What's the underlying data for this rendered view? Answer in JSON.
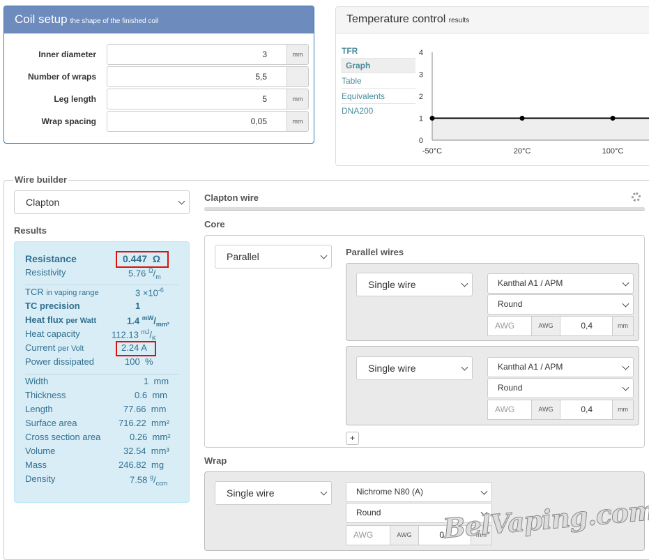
{
  "coil_setup": {
    "title": "Coil setup",
    "subtitle": "the shape of the finished coil",
    "fields": [
      {
        "label": "Inner diameter",
        "value": "3",
        "unit": "mm"
      },
      {
        "label": "Number of wraps",
        "value": "5,5",
        "unit": ""
      },
      {
        "label": "Leg length",
        "value": "5",
        "unit": "mm"
      },
      {
        "label": "Wrap spacing",
        "value": "0,05",
        "unit": "mm"
      }
    ]
  },
  "temperature_control": {
    "title": "Temperature control",
    "subtitle": "results",
    "nav": [
      "TFR",
      "Graph",
      "Table",
      "Equivalents",
      "DNA200"
    ],
    "active_nav": "Graph"
  },
  "chart_data": {
    "type": "line",
    "x": [
      "-50°C",
      "20°C",
      "100°C"
    ],
    "series": [
      {
        "values": [
          1,
          1,
          1
        ]
      }
    ],
    "y_ticks": [
      "0",
      "1",
      "2",
      "3",
      "4"
    ],
    "ylim": [
      0,
      4
    ],
    "line_color": "#000000",
    "fill_color": "#eeeeee"
  },
  "wire_builder": {
    "legend": "Wire builder",
    "wire_type": "Clapton",
    "results_heading": "Results",
    "results": {
      "resistance_label": "Resistance",
      "resistance_value": "0.447",
      "resistance_unit": "Ω",
      "resistivity_label": "Resistivity",
      "resistivity_value": "5.76",
      "resistivity_unit_top": "Ω",
      "resistivity_unit_bottom": "m",
      "tcr_label": "TCR",
      "tcr_small": "in vaping range",
      "tcr_value": "3 ×10",
      "tcr_exp": "-6",
      "tc_precision_label": "TC precision",
      "tc_precision_value": "1",
      "heat_flux_label": "Heat flux",
      "heat_flux_small": "per Watt",
      "heat_flux_value": "1.4",
      "heat_flux_unit_top": "mW",
      "heat_flux_unit_bottom": "mm²",
      "heat_capacity_label": "Heat capacity",
      "heat_capacity_value": "112.13",
      "heat_capacity_unit_top": "mJ",
      "heat_capacity_unit_bottom": "K",
      "current_label": "Current",
      "current_small": "per Volt",
      "current_value": "2.24",
      "current_unit": "A",
      "power_label": "Power dissipated",
      "power_value": "100",
      "power_unit": "%",
      "width_label": "Width",
      "width_value": "1",
      "width_unit": "mm",
      "thickness_label": "Thickness",
      "thickness_value": "0.6",
      "thickness_unit": "mm",
      "length_label": "Length",
      "length_value": "77.66",
      "length_unit": "mm",
      "surface_label": "Surface area",
      "surface_value": "716.22",
      "surface_unit": "mm²",
      "cross_label": "Cross section area",
      "cross_value": "0.26",
      "cross_unit": "mm²",
      "volume_label": "Volume",
      "volume_value": "32.54",
      "volume_unit": "mm³",
      "mass_label": "Mass",
      "mass_value": "246.82",
      "mass_unit": "mg",
      "density_label": "Density",
      "density_value": "7.58",
      "density_unit_top": "g",
      "density_unit_bottom": "ccm"
    },
    "clapton_title": "Clapton wire",
    "core_heading": "Core",
    "core_mode": "Parallel",
    "parallel_heading": "Parallel wires",
    "parallel_wires": [
      {
        "type": "Single wire",
        "material": "Kanthal A1 / APM",
        "shape": "Round",
        "awg_placeholder": "AWG",
        "awg_label": "AWG",
        "diameter": "0,4",
        "unit": "mm"
      },
      {
        "type": "Single wire",
        "material": "Kanthal A1 / APM",
        "shape": "Round",
        "awg_placeholder": "AWG",
        "awg_label": "AWG",
        "diameter": "0,4",
        "unit": "mm"
      }
    ],
    "add_label": "+",
    "wrap_heading": "Wrap",
    "wrap": {
      "type": "Single wire",
      "material": "Nichrome N80 (A)",
      "shape": "Round",
      "awg_placeholder": "AWG",
      "awg_label": "AWG",
      "diameter": "0,1",
      "unit": "mm"
    }
  },
  "watermark": "BelVaping.com"
}
